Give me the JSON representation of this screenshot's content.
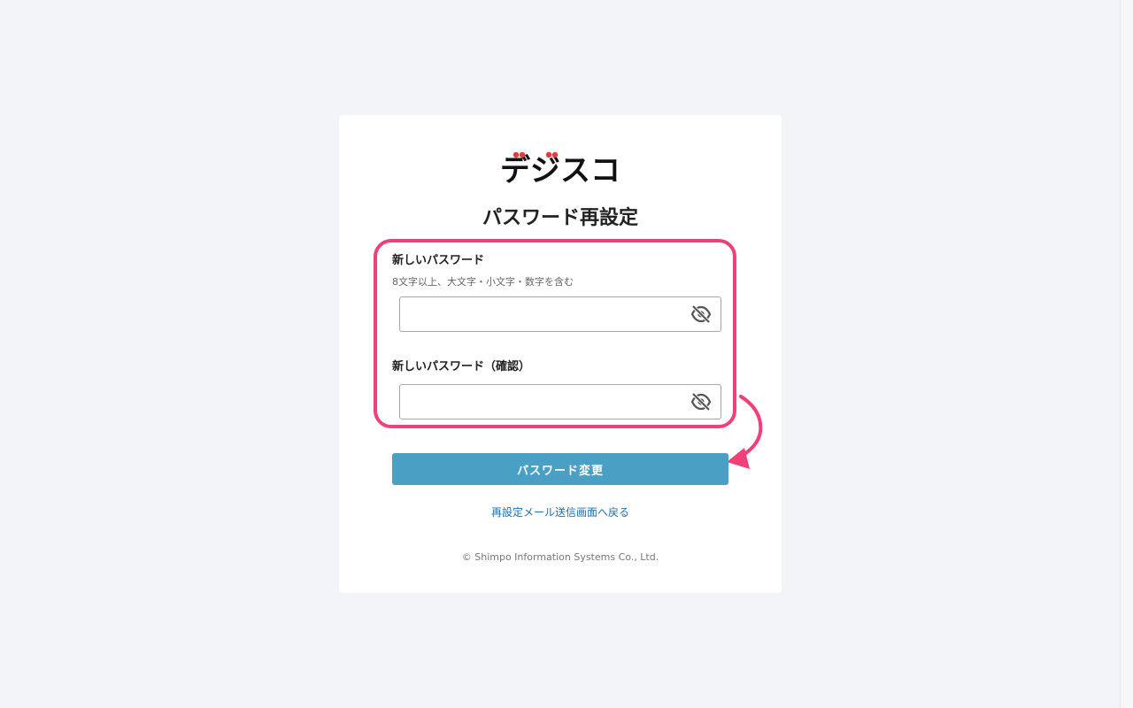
{
  "app": {
    "logo_text": "デジスコ",
    "page_title": "パスワード再設定"
  },
  "form": {
    "new_password": {
      "label": "新しいパスワード",
      "hint": "8文字以上、大文字・小文字・数字を含む",
      "value": "",
      "toggle_icon": "eye-slash-icon"
    },
    "confirm_password": {
      "label": "新しいパスワード（確認）",
      "value": "",
      "toggle_icon": "eye-slash-icon"
    },
    "submit_label": "パスワード変更",
    "back_link_label": "再設定メール送信画面へ戻る"
  },
  "footer": {
    "copyright": "© Shimpo Information Systems Co., Ltd."
  },
  "colors": {
    "background": "#f3f4f8",
    "button": "#4a9fc5",
    "link": "#1f6fb2",
    "highlight": "#f0407a",
    "logo_accent": "#e83a3a"
  }
}
